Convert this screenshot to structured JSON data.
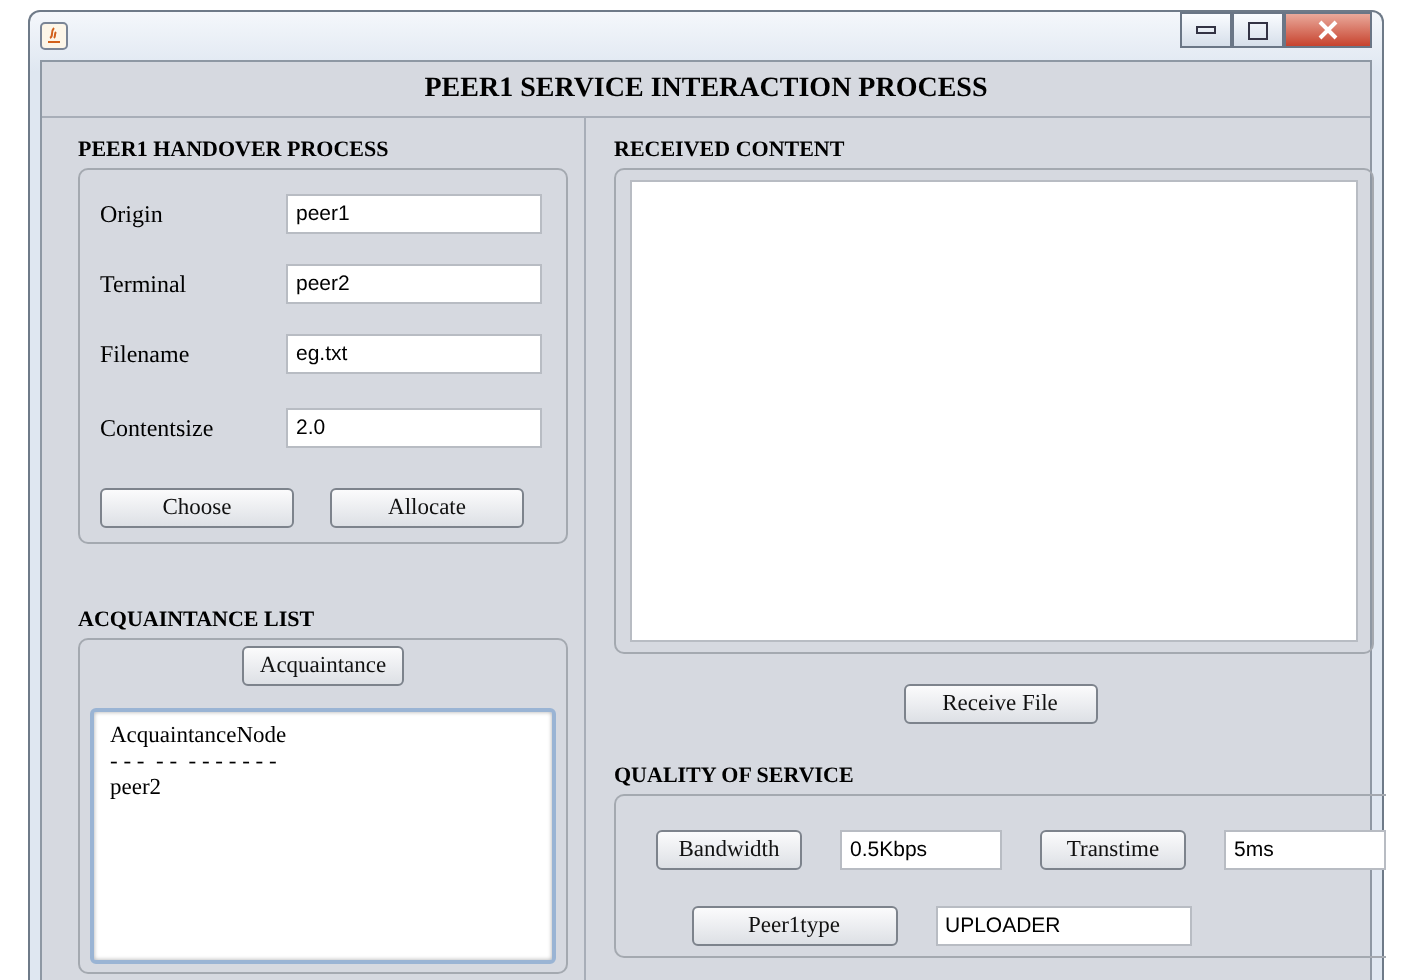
{
  "window": {
    "title": "PEER1 SERVICE INTERACTION PROCESS"
  },
  "handover": {
    "title": "PEER1 HANDOVER PROCESS",
    "fields": [
      {
        "label": "Origin",
        "value": "peer1"
      },
      {
        "label": "Terminal",
        "value": "peer2"
      },
      {
        "label": "Filename",
        "value": "eg.txt"
      },
      {
        "label": "Contentsize",
        "value": "2.0"
      }
    ],
    "buttons": [
      "Choose",
      "Allocate"
    ]
  },
  "acquaintance": {
    "title": "ACQUAINTANCE LIST",
    "button": "Acquaintance",
    "lines": [
      "AcquaintanceNode",
      "- - -  - -  - - - - - - -",
      "peer2"
    ]
  },
  "received": {
    "title": "RECEIVED CONTENT",
    "button": "Receive File"
  },
  "qos": {
    "title": "QUALITY OF SERVICE",
    "rows": [
      [
        {
          "button": "Bandwidth",
          "value": "0.5Kbps"
        },
        {
          "button": "Transtime",
          "value": "5ms"
        }
      ],
      [
        {
          "button": "Peer1type",
          "value": "UPLOADER"
        }
      ]
    ]
  }
}
